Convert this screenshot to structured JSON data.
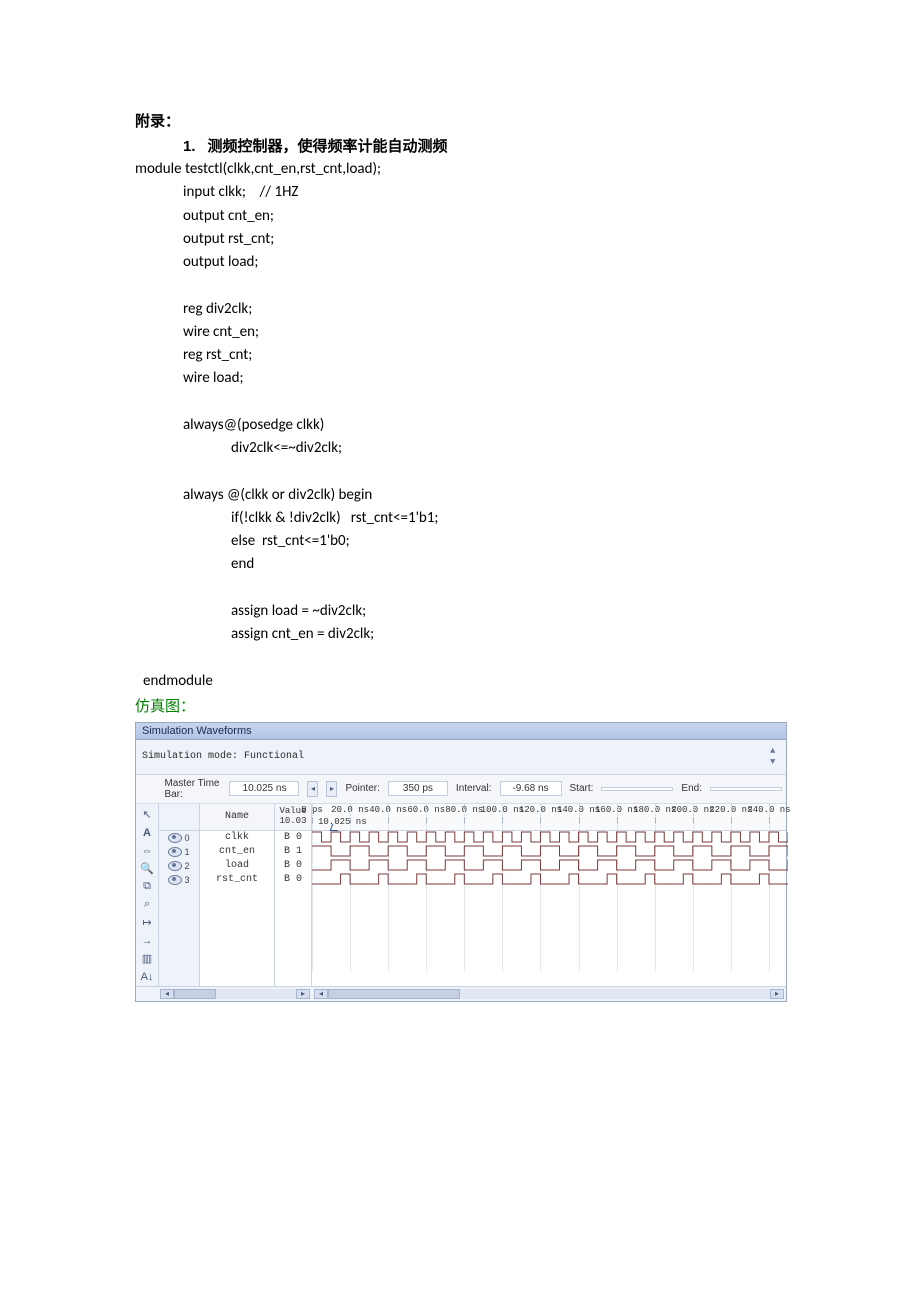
{
  "doc": {
    "appendix_title": "附录：",
    "section1_num": "1.",
    "section1_title": "测频控制器，使得频率计能自动测频",
    "code_lines": [
      {
        "cls": "",
        "txt": "module testctl(clkk,cnt_en,rst_cnt,load);"
      },
      {
        "cls": "ind1",
        "txt": "input clkk;    // 1HZ"
      },
      {
        "cls": "ind1",
        "txt": "output cnt_en;"
      },
      {
        "cls": "ind1",
        "txt": "output rst_cnt;"
      },
      {
        "cls": "ind1",
        "txt": "output load;"
      },
      {
        "cls": "ind1",
        "txt": ""
      },
      {
        "cls": "ind1",
        "txt": "reg div2clk;"
      },
      {
        "cls": "ind1",
        "txt": "wire cnt_en;"
      },
      {
        "cls": "ind1",
        "txt": "reg rst_cnt;"
      },
      {
        "cls": "ind1",
        "txt": "wire load;"
      },
      {
        "cls": "ind1",
        "txt": ""
      },
      {
        "cls": "ind1",
        "txt": "always@(posedge clkk)"
      },
      {
        "cls": "ind2",
        "txt": "div2clk<=~div2clk;"
      },
      {
        "cls": "ind1",
        "txt": ""
      },
      {
        "cls": "ind1",
        "txt": "always @(clkk or div2clk) begin"
      },
      {
        "cls": "ind2",
        "txt": "if(!clkk & !div2clk)   rst_cnt<=1'b1;"
      },
      {
        "cls": "ind2",
        "txt": "else  rst_cnt<=1'b0;"
      },
      {
        "cls": "ind2",
        "txt": "end"
      },
      {
        "cls": "ind2",
        "txt": ""
      },
      {
        "cls": "ind2",
        "txt": "assign load = ~div2clk;"
      },
      {
        "cls": "ind2",
        "txt": "assign cnt_en = div2clk;"
      },
      {
        "cls": "",
        "txt": ""
      },
      {
        "cls": "ind0e",
        "txt": "endmodule"
      }
    ],
    "simgraph_label": "仿真图："
  },
  "wave": {
    "title": "Simulation Waveforms",
    "mode": "Simulation mode: Functional",
    "timebar": {
      "master_lbl": "Master Time Bar:",
      "master_val": "10.025 ns",
      "pointer_lbl": "Pointer:",
      "pointer_val": "350 ps",
      "interval_lbl": "Interval:",
      "interval_val": "-9.68 ns",
      "start_lbl": "Start:",
      "start_val": "",
      "end_lbl": "End:",
      "end_val": ""
    },
    "col_name_header": "Name",
    "col_value_header_l1": "Value",
    "col_value_header_l2": "10.03",
    "cursor_label": "10.025 ns",
    "ticks": [
      "0 ps",
      "20.0 ns",
      "40.0 ns",
      "60.0 ns",
      "80.0 ns",
      "100.0 ns",
      "120.0 ns",
      "140.0 ns",
      "160.0 ns",
      "180.0 ns",
      "200.0 ns",
      "220.0 ns",
      "240.0 ns"
    ],
    "signals": [
      {
        "idx": "0",
        "name": "clkk",
        "value": "B 0"
      },
      {
        "idx": "1",
        "name": "cnt_en",
        "value": "B 1"
      },
      {
        "idx": "2",
        "name": "load",
        "value": "B 0"
      },
      {
        "idx": "3",
        "name": "rst_cnt",
        "value": "B 0"
      }
    ]
  },
  "chart_data": {
    "type": "table",
    "title": "Simulation Waveforms — Functional",
    "time_axis_ns": [
      0,
      20,
      40,
      60,
      80,
      100,
      120,
      140,
      160,
      180,
      200,
      220,
      240
    ],
    "cursor_ns": 10.025,
    "signals": {
      "clkk": {
        "period_ns": 10,
        "duty": 0.5,
        "value_at_cursor": 0,
        "pattern": "square 0→1 every 5 ns"
      },
      "cnt_en": {
        "period_ns": 20,
        "duty": 0.5,
        "value_at_cursor": 1,
        "pattern": "high 10 ns / low 10 ns, starts high at 0"
      },
      "load": {
        "period_ns": 20,
        "duty": 0.5,
        "value_at_cursor": 0,
        "pattern": "inverse of cnt_en"
      },
      "rst_cnt": {
        "period_ns": 20,
        "high_ns": 5,
        "value_at_cursor": 0,
        "pattern": "5 ns pulse every 20 ns, pulse starts at 15 ns"
      }
    }
  }
}
